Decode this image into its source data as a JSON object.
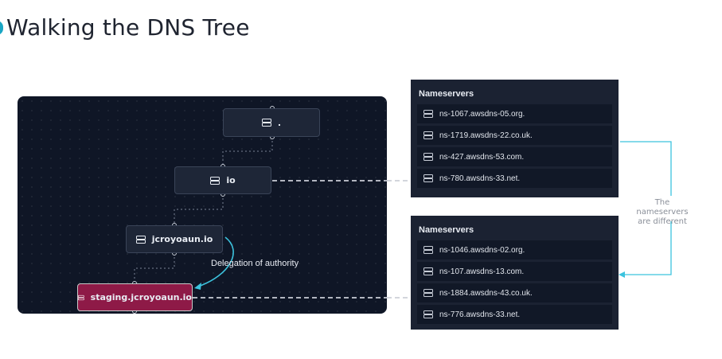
{
  "title": "Walking the DNS Tree",
  "tree": {
    "root": ".",
    "io": "io",
    "jcroyoaun": "jcroyoaun.io",
    "staging": "staging.jcroyoaun.io"
  },
  "annotation": "Delegation of authority",
  "panels": [
    {
      "title": "Nameservers",
      "items": [
        "ns-1067.awsdns-05.org.",
        "ns-1719.awsdns-22.co.uk.",
        "ns-427.awsdns-53.com.",
        "ns-780.awsdns-33.net."
      ]
    },
    {
      "title": "Nameservers",
      "items": [
        "ns-1046.awsdns-02.org.",
        "ns-107.awsdns-13.com.",
        "ns-1884.awsdns-43.co.uk.",
        "ns-776.awsdns-33.net."
      ]
    }
  ],
  "note": {
    "line1": "The nameservers",
    "line2": "are different"
  },
  "colors": {
    "accent": "#1aa6c4",
    "active_node": "#8e1a47",
    "canvas": "#0f1626",
    "panel": "#1b2232"
  },
  "icons": {
    "node": "server-icon",
    "item": "server-icon"
  }
}
